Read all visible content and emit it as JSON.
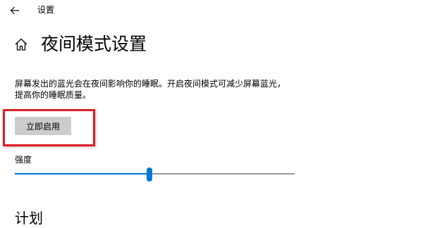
{
  "window": {
    "title": "设置",
    "back_icon": "back-arrow-icon"
  },
  "header": {
    "home_icon": "home-icon",
    "title": "夜间模式设置"
  },
  "description": {
    "line1": "屏幕发出的蓝光会在夜间影响你的睡眠。开启夜间模式可减少屏幕蓝光，",
    "line2": "提高你的睡眠质量。"
  },
  "actions": {
    "enable_now_label": "立即启用"
  },
  "strength": {
    "label": "强度",
    "value_fraction": 0.48,
    "accent_color": "#0078d7",
    "track_color": "#999999"
  },
  "annotation": {
    "highlight_color": "#d9202a"
  },
  "next_section": {
    "heading": "计划"
  }
}
